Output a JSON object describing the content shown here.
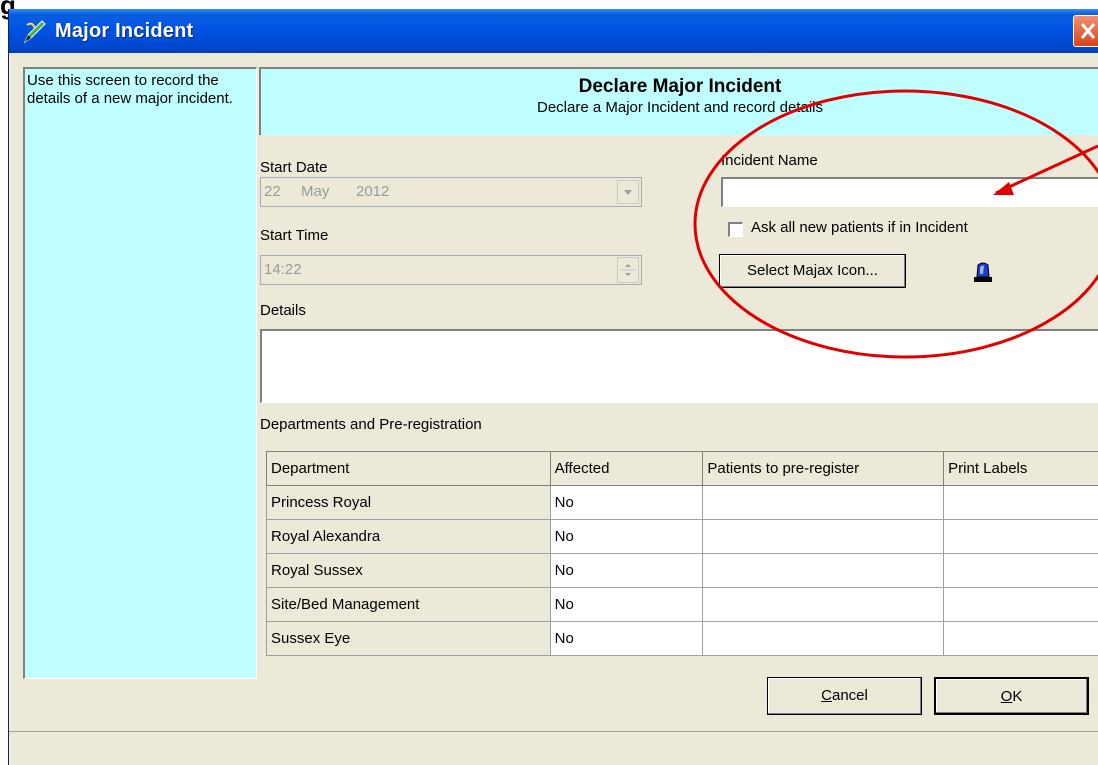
{
  "top_letter": "g",
  "window": {
    "title": "Major Incident"
  },
  "help_text": "Use this screen to record the details of a new major incident.",
  "banner": {
    "title": "Declare Major Incident",
    "subtitle": "Declare a Major Incident and record details"
  },
  "start_date": {
    "label": "Start Date",
    "day": "22",
    "month": "May",
    "year": "2012"
  },
  "start_time": {
    "label": "Start Time",
    "value": "14:22"
  },
  "incident_name": {
    "label": "Incident Name",
    "value": ""
  },
  "ask_patients": {
    "label": "Ask all new patients if in Incident",
    "checked": false
  },
  "majax_button": {
    "label": "Select Majax Icon..."
  },
  "details": {
    "label": "Details",
    "value": ""
  },
  "departments": {
    "label": "Departments and Pre-registration",
    "columns": [
      "Department",
      "Affected",
      "Patients to pre-register",
      "Print Labels"
    ],
    "rows": [
      [
        "Princess Royal",
        "No",
        "",
        ""
      ],
      [
        "Royal Alexandra",
        "No",
        "",
        ""
      ],
      [
        "Royal Sussex",
        "No",
        "",
        ""
      ],
      [
        "Site/Bed Management",
        "No",
        "",
        ""
      ],
      [
        "Sussex Eye",
        "No",
        "",
        ""
      ]
    ]
  },
  "buttons": {
    "cancel": "Cancel",
    "ok": "OK"
  },
  "colors": {
    "title_bar": "#0054e3",
    "info_panel": "#c0ffff",
    "window_bg": "#ece9d8",
    "annotation": "#e00000"
  },
  "icons": {
    "title": "pen-icon",
    "close": "close-icon",
    "majax": "siren-icon"
  }
}
